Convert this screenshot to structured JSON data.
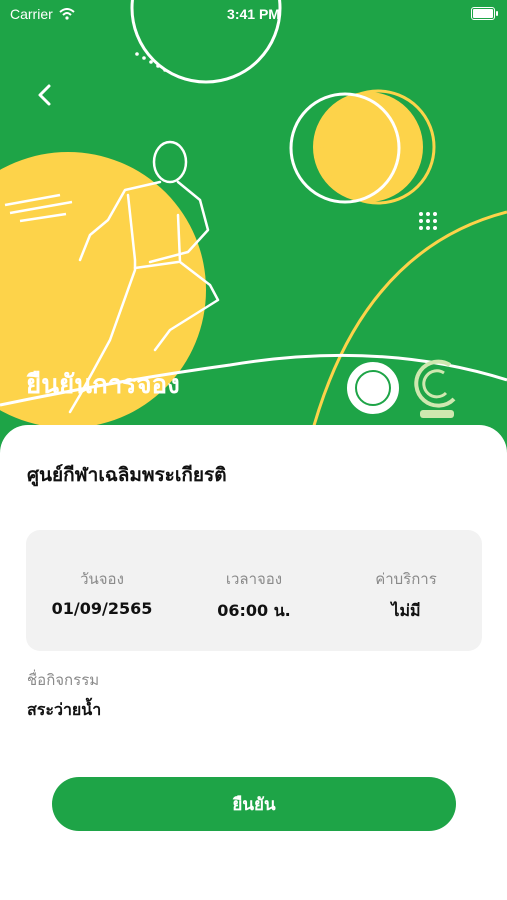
{
  "status_bar": {
    "carrier": "Carrier",
    "time": "3:41 PM"
  },
  "header": {
    "title": "ยืนยันการจอง",
    "back_icon": "chevron-left-icon"
  },
  "venue": {
    "name": "ศูนย์กีฬาเฉลิมพระเกียรติ"
  },
  "booking_info": [
    {
      "label": "วันจอง",
      "value": "01/09/2565"
    },
    {
      "label": "เวลาจอง",
      "value": "06:00 น."
    },
    {
      "label": "ค่าบริการ",
      "value": "ไม่มี"
    }
  ],
  "activity": {
    "label": "ชื่อกิจกรรม",
    "value": "สระว่ายน้ำ"
  },
  "confirm_button": {
    "label": "ยืนยัน"
  },
  "colors": {
    "primary": "#1ea447",
    "accent": "#ffd54a"
  }
}
